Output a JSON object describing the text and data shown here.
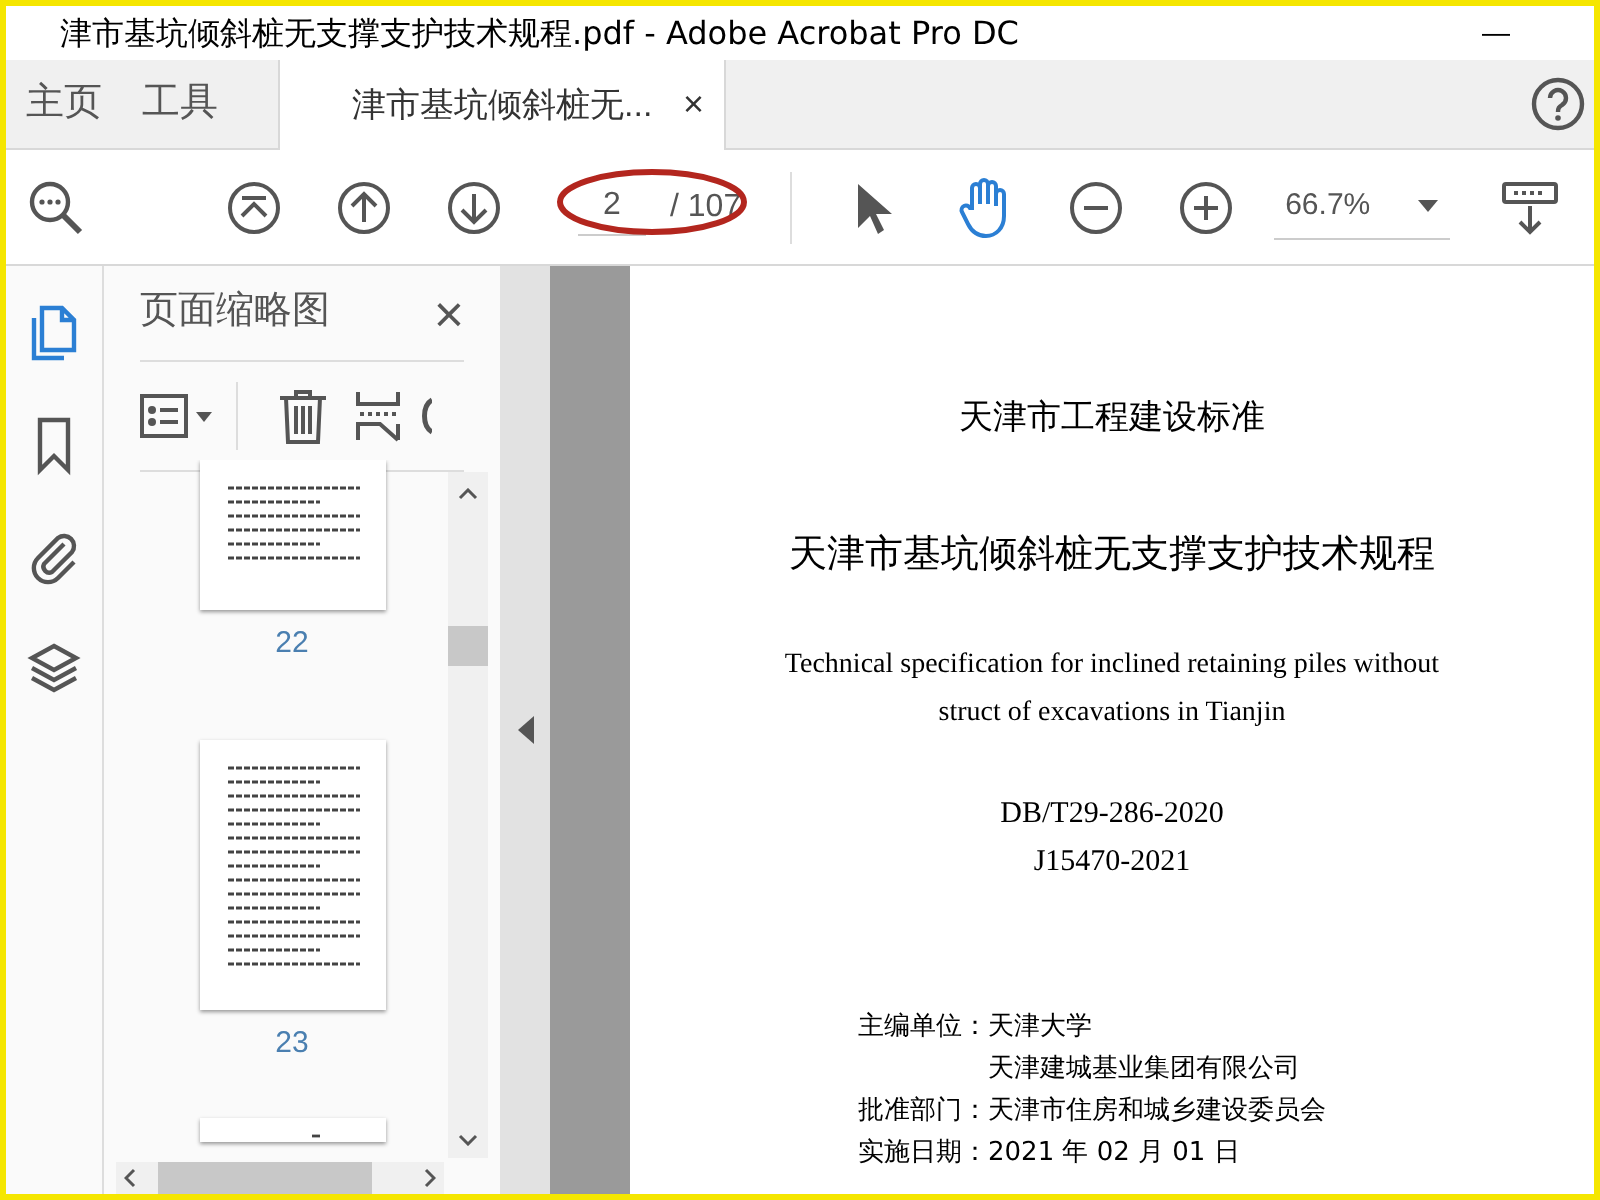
{
  "window": {
    "title": "津市基坑倾斜桩无支撑支护技术规程.pdf - Adobe Acrobat Pro DC",
    "minimize": "—"
  },
  "tabs": [
    {
      "label": "主页",
      "selected": false,
      "kind": "nav"
    },
    {
      "label": "工具",
      "selected": false,
      "kind": "nav"
    },
    {
      "label": "津市基坑倾斜桩无...",
      "selected": true,
      "kind": "doc",
      "close": "×"
    }
  ],
  "toolbar": {
    "page_number": "2",
    "page_total": "/ 107",
    "zoom": "66.7%",
    "hand_tool_selected": true
  },
  "side_rail": [
    {
      "kind": "pages",
      "selected": true
    },
    {
      "kind": "bookmark",
      "selected": false
    },
    {
      "kind": "attachment",
      "selected": false
    },
    {
      "kind": "layers",
      "selected": false
    }
  ],
  "thumbnail_panel": {
    "title": "页面缩略图",
    "close": "×",
    "pages": [
      {
        "label": "22"
      },
      {
        "label": "23"
      }
    ]
  },
  "document": {
    "lines": [
      {
        "kind": "heading",
        "text": "天津市工程建设标准"
      },
      {
        "kind": "title",
        "text": "天津市基坑倾斜桩无支撑支护技术规程"
      },
      {
        "kind": "english",
        "text": "Technical specification for inclined retaining piles without"
      },
      {
        "kind": "english",
        "text": "struct of excavations in Tianjin"
      },
      {
        "kind": "code",
        "text": "DB/T29-286-2020"
      },
      {
        "kind": "code",
        "text": "J15470-2021"
      }
    ],
    "info": [
      {
        "label": "主编单位：",
        "value": "天津大学"
      },
      {
        "value": "天津建城基业集团有限公司"
      },
      {
        "label": "批准部门：",
        "value": "天津市住房和城乡建设委员会"
      },
      {
        "label": "实施日期：",
        "value": "2021 年 02 月 01 日"
      }
    ]
  }
}
